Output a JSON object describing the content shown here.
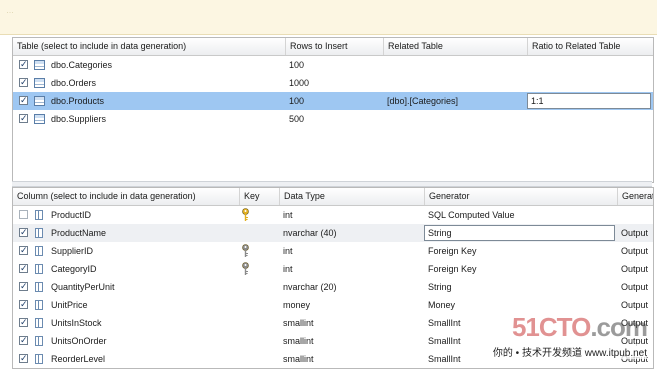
{
  "top_banner": {
    "text": "…"
  },
  "tables_grid": {
    "headers": [
      "Table (select to include in data generation)",
      "Rows to Insert",
      "Related Table",
      "Ratio to Related Table"
    ],
    "rows": [
      {
        "checked": true,
        "name": "dbo.Categories",
        "rows": "100",
        "related": "",
        "ratio": ""
      },
      {
        "checked": true,
        "name": "dbo.Orders",
        "rows": "1000",
        "related": "",
        "ratio": ""
      },
      {
        "checked": true,
        "name": "dbo.Products",
        "rows": "100",
        "related": "[dbo].[Categories]",
        "ratio": "1:1",
        "selected": true
      },
      {
        "checked": true,
        "name": "dbo.Suppliers",
        "rows": "500",
        "related": "",
        "ratio": ""
      }
    ]
  },
  "columns_grid": {
    "headers": [
      "Column (select to include in data generation)",
      "Key",
      "Data Type",
      "Generator",
      "Generat"
    ],
    "rows": [
      {
        "checked": false,
        "name": "ProductID",
        "key": "primary",
        "type": "int",
        "generator": "SQL Computed Value",
        "output": ""
      },
      {
        "checked": true,
        "name": "ProductName",
        "key": "",
        "type": "nvarchar (40)",
        "generator": "String",
        "output": "Output",
        "highlight": true
      },
      {
        "checked": true,
        "name": "SupplierID",
        "key": "foreign",
        "type": "int",
        "generator": "Foreign Key",
        "output": "Output"
      },
      {
        "checked": true,
        "name": "CategoryID",
        "key": "foreign",
        "type": "int",
        "generator": "Foreign Key",
        "output": "Output"
      },
      {
        "checked": true,
        "name": "QuantityPerUnit",
        "key": "",
        "type": "nvarchar (20)",
        "generator": "String",
        "output": "Output"
      },
      {
        "checked": true,
        "name": "UnitPrice",
        "key": "",
        "type": "money",
        "generator": "Money",
        "output": "Output"
      },
      {
        "checked": true,
        "name": "UnitsInStock",
        "key": "",
        "type": "smallint",
        "generator": "SmallInt",
        "output": "Output"
      },
      {
        "checked": true,
        "name": "UnitsOnOrder",
        "key": "",
        "type": "smallint",
        "generator": "SmallInt",
        "output": "Output"
      },
      {
        "checked": true,
        "name": "ReorderLevel",
        "key": "",
        "type": "smallint",
        "generator": "SmallInt",
        "output": "Output"
      }
    ]
  },
  "watermark": {
    "logo_main": "51CTO",
    "logo_suffix": ".com",
    "subtitle": "你的 • 技术开发频道  www.itpub.net"
  },
  "colors": {
    "selected_row": "#9ec7f2",
    "banner": "#fcf6e2"
  }
}
